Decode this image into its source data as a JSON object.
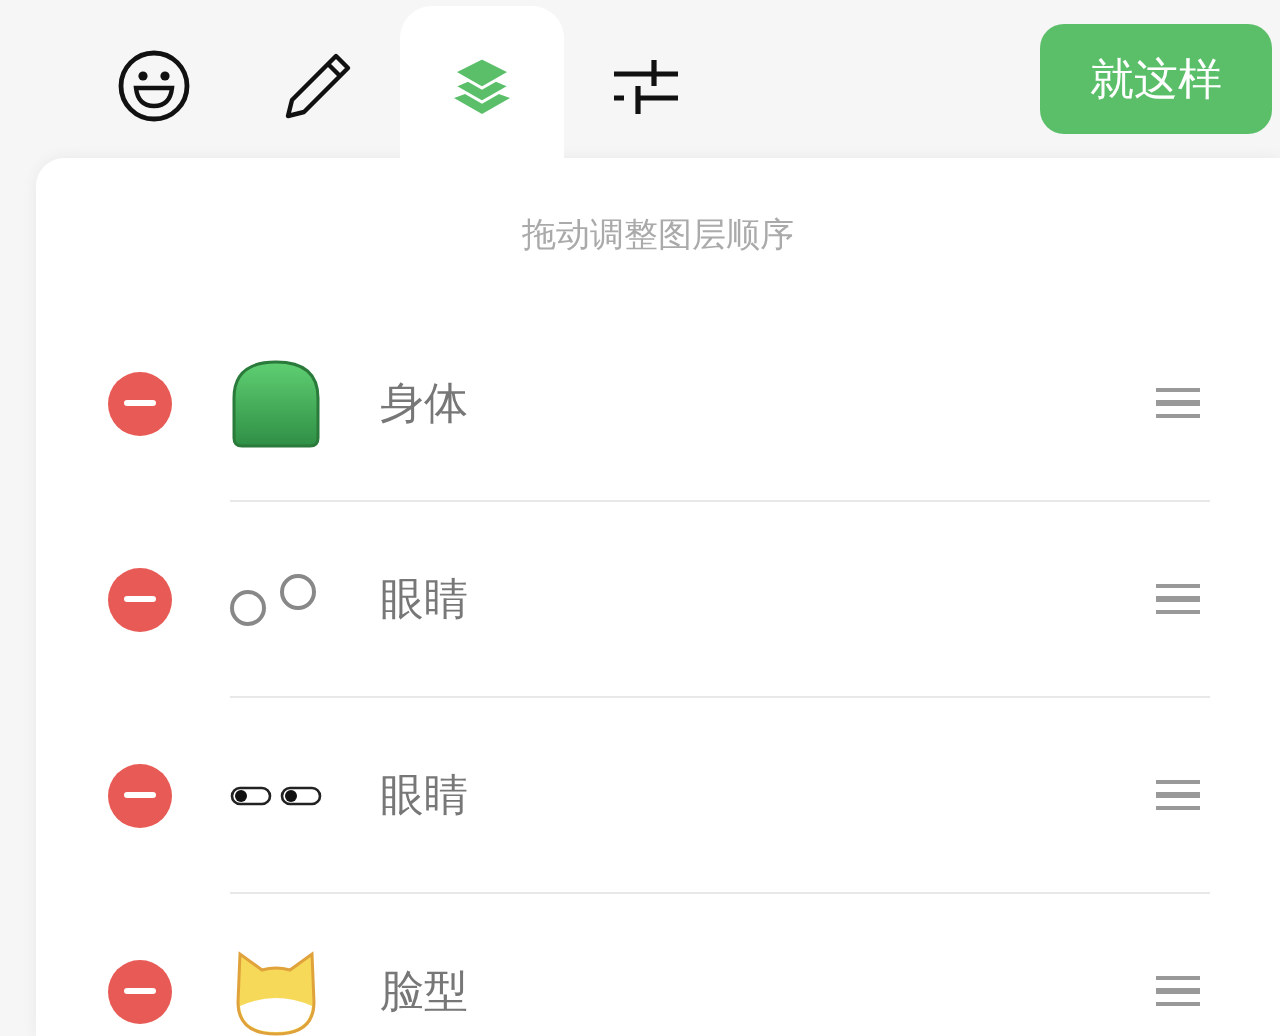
{
  "tabs": [
    {
      "kind": "emoji",
      "selected": false
    },
    {
      "kind": "pencil",
      "selected": false
    },
    {
      "kind": "layers",
      "selected": true
    },
    {
      "kind": "sliders",
      "selected": false
    }
  ],
  "done_button": "就这样",
  "hint": "拖动调整图层顺序",
  "layers": [
    {
      "kind": "body",
      "label": "身体"
    },
    {
      "kind": "eyes-ring",
      "label": "眼睛"
    },
    {
      "kind": "eyes-pill",
      "label": "眼睛"
    },
    {
      "kind": "face",
      "label": "脸型"
    }
  ]
}
